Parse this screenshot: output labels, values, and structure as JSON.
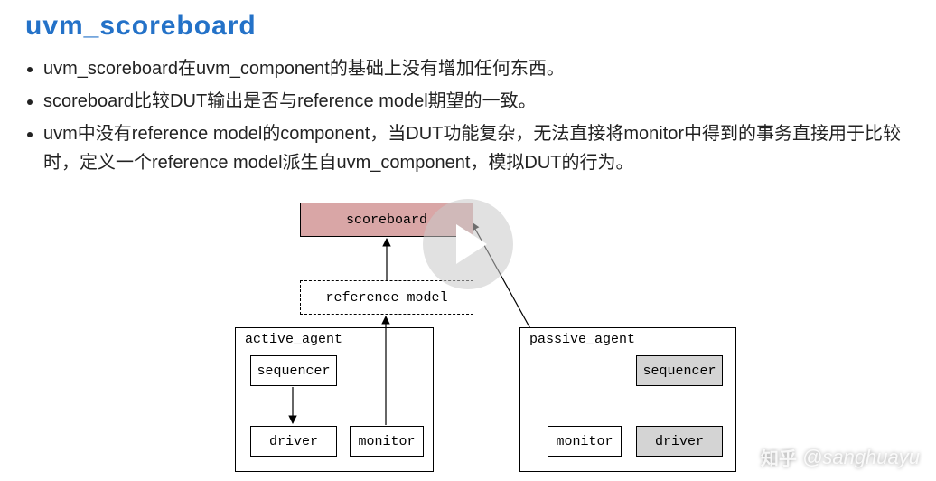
{
  "title": "uvm_scoreboard",
  "bullets": [
    "uvm_scoreboard在uvm_component的基础上没有增加任何东西。",
    "scoreboard比较DUT输出是否与reference model期望的一致。",
    "uvm中没有reference model的component，当DUT功能复杂，无法直接将monitor中得到的事务直接用于比较时，定义一个reference model派生自uvm_component，模拟DUT的行为。"
  ],
  "diagram": {
    "scoreboard": "scoreboard",
    "reference_model": "reference model",
    "active_agent": {
      "label": "active_agent",
      "sequencer": "sequencer",
      "driver": "driver",
      "monitor": "monitor"
    },
    "passive_agent": {
      "label": "passive_agent",
      "sequencer": "sequencer",
      "driver": "driver",
      "monitor": "monitor"
    },
    "edges": [
      {
        "from": "reference_model",
        "to": "scoreboard"
      },
      {
        "from": "active_agent.monitor",
        "to": "reference_model"
      },
      {
        "from": "active_agent.sequencer",
        "to": "active_agent.driver"
      },
      {
        "from": "passive_agent.monitor",
        "to": "scoreboard"
      },
      {
        "from": "passive_agent.sequencer",
        "to": "passive_agent.driver"
      }
    ]
  },
  "overlay": {
    "play_button": "play-icon",
    "watermark_platform": "知乎",
    "watermark_user": "@sanghuayu"
  }
}
